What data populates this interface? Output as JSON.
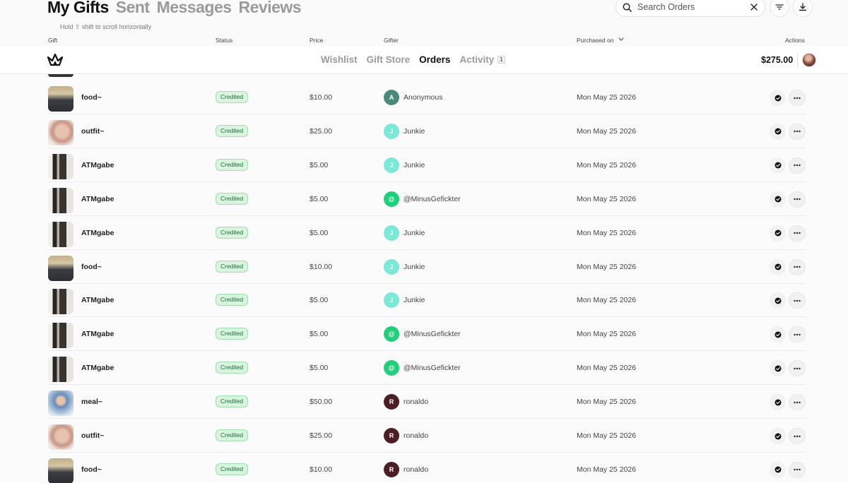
{
  "page_tabs": [
    {
      "label": "My Gifts",
      "active": true
    },
    {
      "label": "Sent",
      "active": false
    },
    {
      "label": "Messages",
      "active": false
    },
    {
      "label": "Reviews",
      "active": false
    }
  ],
  "hint": "Hold ⇧ shift to scroll horizontally",
  "search": {
    "placeholder": "Search Orders",
    "value": ""
  },
  "toolbar": {
    "filter_icon": "filter-icon",
    "download_icon": "download-icon",
    "clear_icon": "close-icon"
  },
  "columns": {
    "gift": "Gift",
    "status": "Status",
    "price": "Price",
    "gifter": "Gifter",
    "purchased_on": "Purchased on",
    "actions": "Actions"
  },
  "nav": {
    "tabs": [
      {
        "label": "Wishlist",
        "active": false,
        "badge": ""
      },
      {
        "label": "Gift Store",
        "active": false,
        "badge": ""
      },
      {
        "label": "Orders",
        "active": true,
        "badge": ""
      },
      {
        "label": "Activity",
        "active": false,
        "badge": "1"
      }
    ],
    "balance": "$275.00"
  },
  "colors": {
    "status_bg": "#d8f5de",
    "status_text": "#1f6b38",
    "anonymous": "#4a8a7a",
    "junkie": "#7ce8d8",
    "minus": "#1fcf7a",
    "ronaldo": "#4a1e22"
  },
  "orders": [
    {
      "thumb": "food",
      "gift": "food~",
      "status": "Credited",
      "price": "$10.00",
      "gifter_initial": "A",
      "gifter_color": "#4a8a7a",
      "gifter": "Anonymous",
      "date": "Mon May 25 2026"
    },
    {
      "thumb": "outfit",
      "gift": "outfit~",
      "status": "Credited",
      "price": "$25.00",
      "gifter_initial": "J",
      "gifter_color": "#7ce8d8",
      "gifter": "Junkie",
      "date": "Mon May 25 2026"
    },
    {
      "thumb": "atm",
      "gift": "ATMgabe",
      "status": "Credited",
      "price": "$5.00",
      "gifter_initial": "J",
      "gifter_color": "#7ce8d8",
      "gifter": "Junkie",
      "date": "Mon May 25 2026"
    },
    {
      "thumb": "atm",
      "gift": "ATMgabe",
      "status": "Credited",
      "price": "$5.00",
      "gifter_initial": "@",
      "gifter_color": "#1fcf7a",
      "gifter": "@MinusGefickter",
      "date": "Mon May 25 2026"
    },
    {
      "thumb": "atm",
      "gift": "ATMgabe",
      "status": "Credited",
      "price": "$5.00",
      "gifter_initial": "J",
      "gifter_color": "#7ce8d8",
      "gifter": "Junkie",
      "date": "Mon May 25 2026"
    },
    {
      "thumb": "food",
      "gift": "food~",
      "status": "Credited",
      "price": "$10.00",
      "gifter_initial": "J",
      "gifter_color": "#7ce8d8",
      "gifter": "Junkie",
      "date": "Mon May 25 2026"
    },
    {
      "thumb": "atm",
      "gift": "ATMgabe",
      "status": "Credited",
      "price": "$5.00",
      "gifter_initial": "J",
      "gifter_color": "#7ce8d8",
      "gifter": "Junkie",
      "date": "Mon May 25 2026"
    },
    {
      "thumb": "atm",
      "gift": "ATMgabe",
      "status": "Credited",
      "price": "$5.00",
      "gifter_initial": "@",
      "gifter_color": "#1fcf7a",
      "gifter": "@MinusGefickter",
      "date": "Mon May 25 2026"
    },
    {
      "thumb": "atm",
      "gift": "ATMgabe",
      "status": "Credited",
      "price": "$5.00",
      "gifter_initial": "@",
      "gifter_color": "#1fcf7a",
      "gifter": "@MinusGefickter",
      "date": "Mon May 25 2026"
    },
    {
      "thumb": "meal",
      "gift": "meal~",
      "status": "Credited",
      "price": "$50.00",
      "gifter_initial": "R",
      "gifter_color": "#4a1e22",
      "gifter": "ronaldo",
      "date": "Mon May 25 2026"
    },
    {
      "thumb": "outfit",
      "gift": "outfit~",
      "status": "Credited",
      "price": "$25.00",
      "gifter_initial": "R",
      "gifter_color": "#4a1e22",
      "gifter": "ronaldo",
      "date": "Mon May 25 2026"
    },
    {
      "thumb": "food",
      "gift": "food~",
      "status": "Credited",
      "price": "$10.00",
      "gifter_initial": "R",
      "gifter_color": "#4a1e22",
      "gifter": "ronaldo",
      "date": "Mon May 25 2026"
    }
  ]
}
